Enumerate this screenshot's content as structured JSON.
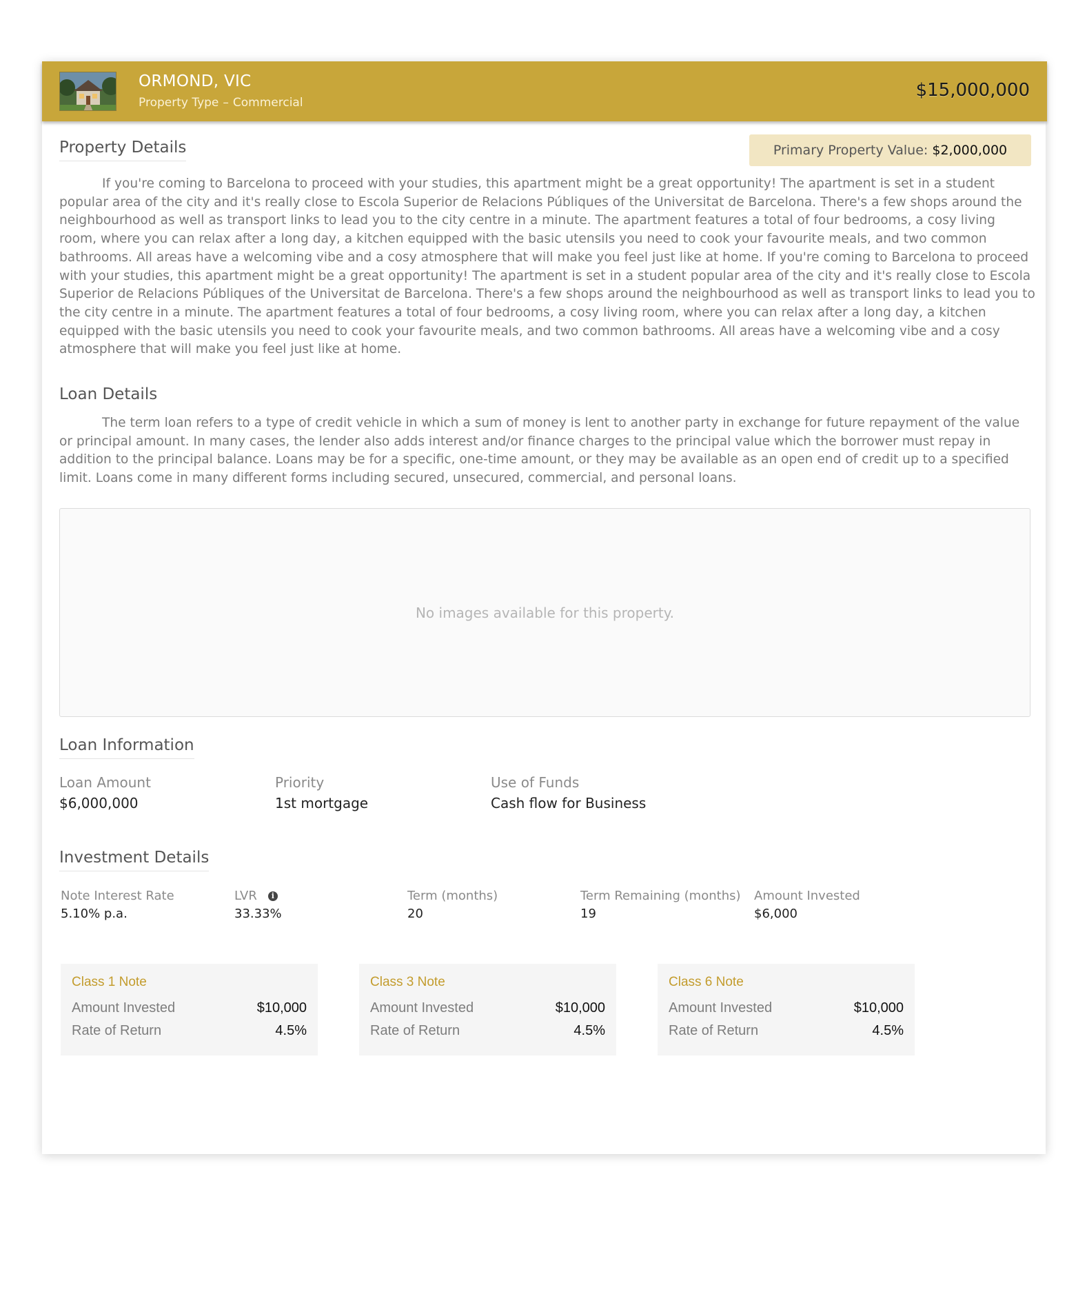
{
  "header": {
    "location": "ORMOND, VIC",
    "property_type_label": "Property Type",
    "property_type_value": "Commercial",
    "price": "$15,000,000",
    "thumbnail_icon": "house-photo-icon"
  },
  "property_details": {
    "title": "Property Details",
    "primary_value_label": "Primary Property Value:",
    "primary_value": "$2,000,000",
    "description": "If you're coming to Barcelona to proceed with your studies, this apartment might be a great opportunity! The apartment is set in a student popular area of the city and it's really close to Escola Superior de Relacions Públiques of the Universitat de Barcelona. There's a few shops around the neighbourhood as well as transport links to lead you to the city centre in a minute. The apartment features a total of four bedrooms, a cosy living room, where you can relax after a long day, a kitchen equipped with the basic utensils you need to cook your favourite meals, and two common bathrooms. All areas have a welcoming vibe and a cosy atmosphere that will make you feel just like at home. If you're coming to Barcelona to proceed with your studies, this apartment might be a great opportunity! The apartment is set in a student popular area of the city and it's really close to Escola Superior de Relacions Públiques of the Universitat de Barcelona. There's a few shops around the neighbourhood as well as transport links to lead you to the city centre in a minute. The apartment features a total of four bedrooms, a cosy living room, where you can relax after a long day, a kitchen equipped with the basic utensils you need to cook your favourite meals, and two common bathrooms. All areas have a welcoming vibe and a cosy atmosphere that will make you feel just like at home."
  },
  "loan_details": {
    "title": "Loan Details",
    "description": "The term loan refers to a type of credit vehicle in which a sum of money is lent to another party in exchange for future repayment of the value or principal amount. In many cases, the lender also adds interest and/or finance charges to the principal value which the borrower must repay in addition to the principal balance. Loans may be for a specific, one-time amount, or they may be available as an  open end of credit up to a specified limit. Loans come in many different forms including secured, unsecured, commercial, and personal loans."
  },
  "images": {
    "empty_message": "No images available for this property."
  },
  "loan_information": {
    "title": "Loan Information",
    "fields": [
      {
        "label": "Loan Amount",
        "value": "$6,000,000"
      },
      {
        "label": "Priority",
        "value": "1st mortgage"
      },
      {
        "label": "Use of Funds",
        "value": "Cash flow for Business"
      }
    ]
  },
  "investment_details": {
    "title": "Investment Details",
    "fields": [
      {
        "label": "Note Interest Rate",
        "value": "5.10% p.a."
      },
      {
        "label": "LVR",
        "value": "33.33%"
      },
      {
        "label": "Term (months)",
        "value": "20"
      },
      {
        "label": "Term Remaining (months)",
        "value": "19"
      },
      {
        "label": "Amount Invested",
        "value": "$6,000"
      }
    ]
  },
  "notes": [
    {
      "title": "Class 1 Note",
      "amount_label": "Amount Invested",
      "amount": "$10,000",
      "rate_label": "Rate of Return",
      "rate": "4.5%"
    },
    {
      "title": "Class 3 Note",
      "amount_label": "Amount Invested",
      "amount": "$10,000",
      "rate_label": "Rate of Return",
      "rate": "4.5%"
    },
    {
      "title": "Class 6 Note",
      "amount_label": "Amount Invested",
      "amount": "$10,000",
      "rate_label": "Rate of Return",
      "rate": "4.5%"
    }
  ],
  "colors": {
    "accent": "#c8a63a",
    "value_badge": "#f2e6c3",
    "note_title": "#c39c2d"
  }
}
